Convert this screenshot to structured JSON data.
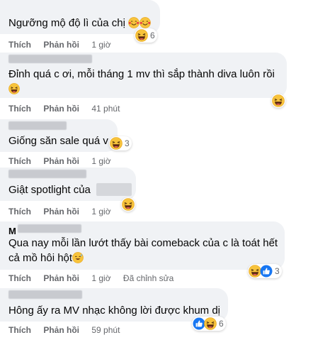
{
  "actions": {
    "like": "Thích",
    "reply": "Phản hồi",
    "edited": "Đã chỉnh sửa"
  },
  "comments": [
    {
      "text": "Ngưỡng mộ độ lì của chị",
      "time": "1 giờ",
      "reaction_count": "6",
      "reactions": [
        "haha-icon"
      ]
    },
    {
      "text": "Đỉnh quá c ơi, mỗi tháng 1 mv thì sắp thành diva luôn rồi",
      "time": "41 phút",
      "reaction_count": "",
      "reactions": [
        "haha-icon"
      ]
    },
    {
      "text": "Giống săn sale quá v",
      "time": "1 giờ",
      "reaction_count": "3",
      "reactions": [
        "haha-icon"
      ]
    },
    {
      "text": "Giật spotlight của",
      "time": "1 giờ",
      "reaction_count": "",
      "reactions": [
        "haha-icon"
      ]
    },
    {
      "name_initial": "M",
      "line1": "Qua nay mỗi lần lướt thấy bài comeback của c là toát hết",
      "line2": "cả mồ hôi hột",
      "time": "1 giờ",
      "reaction_count": "3",
      "reactions": [
        "haha-icon",
        "like-icon"
      ]
    },
    {
      "text": "Hông ấy ra MV nhạc không lời được khum dị",
      "time": "59 phút",
      "reaction_count": "6",
      "reactions": [
        "like-icon",
        "haha-icon"
      ]
    }
  ],
  "colors": {
    "bubble": "#f0f2f5",
    "action_text": "#65676b",
    "like_blue": "#1877f2",
    "haha_yellow": "#f7b125"
  }
}
